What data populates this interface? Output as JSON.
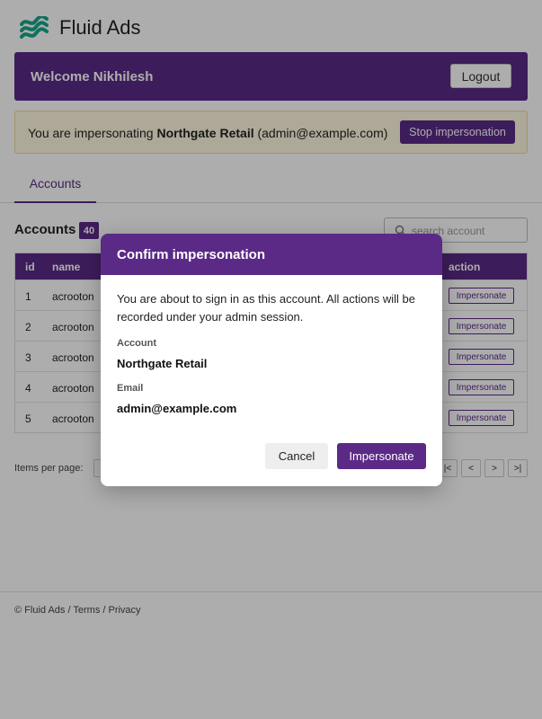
{
  "brand": {
    "name": "Fluid Ads",
    "logo_icon": "wave-logo-icon",
    "logo_color": "#17a589"
  },
  "colors": {
    "accent": "#5b2a86",
    "banner_bg": "#fff8e1"
  },
  "welcome": {
    "text": "Welcome Nikhilesh",
    "logout_label": "Logout"
  },
  "impersonation_banner": {
    "prefix": "You are impersonating ",
    "account_name": "Northgate Retail",
    "suffix": " (admin@example.com)",
    "stop_label": "Stop impersonation"
  },
  "tabs": [
    {
      "label": "Accounts",
      "active": true
    }
  ],
  "accounts": {
    "title": "Accounts",
    "count": "40",
    "search_placeholder": "search account",
    "columns": {
      "id": "id",
      "name": "name",
      "action": "action"
    },
    "rows": [
      {
        "id": "1",
        "name": "acrooton",
        "action": "Impersonate"
      },
      {
        "id": "2",
        "name": "acrooton",
        "action": "Impersonate"
      },
      {
        "id": "3",
        "name": "acrooton",
        "action": "Impersonate"
      },
      {
        "id": "4",
        "name": "acrooton",
        "action": "Impersonate"
      },
      {
        "id": "5",
        "name": "acrooton",
        "action": "Impersonate"
      }
    ]
  },
  "pagination": {
    "items_per_page_label": "Items per page:",
    "first": "|<",
    "prev": "<",
    "next": ">",
    "last": ">|"
  },
  "footer": {
    "text": "© Fluid Ads / Terms / Privacy"
  },
  "modal": {
    "title": "Confirm impersonation",
    "message": "You are about to sign in as this account. All actions will be recorded under your admin session.",
    "account_label": "Account",
    "account_value": "Northgate Retail",
    "email_label": "Email",
    "email_value": "admin@example.com",
    "cancel_label": "Cancel",
    "confirm_label": "Impersonate"
  }
}
